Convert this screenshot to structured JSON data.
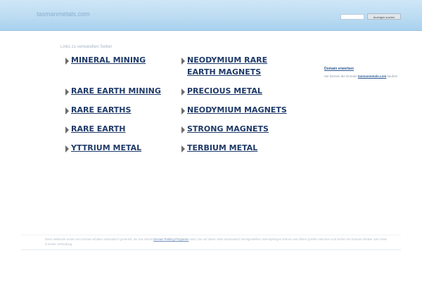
{
  "header": {
    "site_name": "tasmanmetals.com",
    "search_placeholder": "",
    "search_button_label": "Anzeigen suchen"
  },
  "links_heading": "Links zu verwandten Seiten",
  "links": [
    {
      "label": "MINERAL MINING"
    },
    {
      "label": "NEODYMIUM RARE EARTH MAGNETS"
    },
    {
      "label": "RARE EARTH MINING"
    },
    {
      "label": "PRECIOUS METAL"
    },
    {
      "label": "RARE EARTHS"
    },
    {
      "label": "NEODYMIUM MAGNETS"
    },
    {
      "label": "RARE EARTH"
    },
    {
      "label": "STRONG MAGNETS"
    },
    {
      "label": "YTTRIUM METAL"
    },
    {
      "label": "TERBIUM METAL"
    }
  ],
  "sidebar": {
    "title": "Domain erwerben",
    "text_prefix": "Sie können die Domain",
    "text_domain": "tasmanmetals.com",
    "text_suffix": "kaufen!"
  },
  "footer": {
    "text_a": "Diese Webseite wurde vom Domain-Inhaber automatisch generiert, der das Dienst",
    "link": "Domain Parking Programm",
    "text_b": "nutzt. Die auf dieser Seite automatisch bereitgestellten Verknüpfungen können aus dritten Quellen stammen und stehen mit Domain-Inhaber oder Seite in keiner Verbindung."
  }
}
